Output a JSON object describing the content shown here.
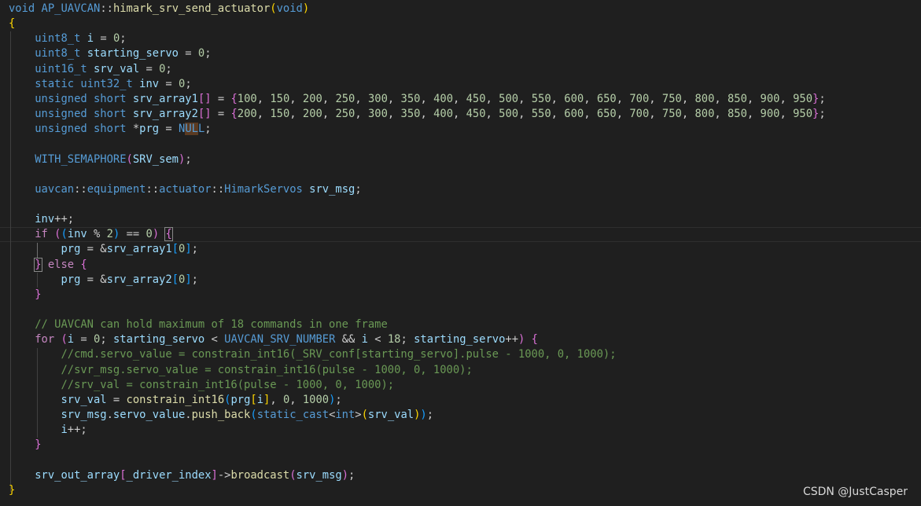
{
  "colors": {
    "background": "#1f1f1f",
    "keyword": "#569cd6",
    "control": "#c586c0",
    "function": "#dcdcaa",
    "variable": "#9cdcfe",
    "number": "#b5cea8",
    "comment": "#6a9955",
    "punctuation": "#cccccc",
    "brace1": "#ffd700",
    "brace2": "#da70d6",
    "brace3": "#179fff",
    "constant": "#4fc1ff"
  },
  "watermark": "CSDN @JustCasper",
  "code": {
    "lines": [
      [
        [
          "void",
          "keyword"
        ],
        [
          " ",
          "punctuation"
        ],
        [
          "AP_UAVCAN",
          "type"
        ],
        [
          "::",
          "punctuation"
        ],
        [
          "himark_srv_send_actuator",
          "function"
        ],
        [
          "(",
          "brace1"
        ],
        [
          "void",
          "keyword"
        ],
        [
          ")",
          "brace1"
        ]
      ],
      [
        [
          "{",
          "brace1"
        ]
      ],
      [
        [
          "    ",
          "punctuation"
        ],
        [
          "uint8_t",
          "keyword"
        ],
        [
          " ",
          "punctuation"
        ],
        [
          "i",
          "variable"
        ],
        [
          " = ",
          "punctuation"
        ],
        [
          "0",
          "number"
        ],
        [
          ";",
          "punctuation"
        ]
      ],
      [
        [
          "    ",
          "punctuation"
        ],
        [
          "uint8_t",
          "keyword"
        ],
        [
          " ",
          "punctuation"
        ],
        [
          "starting_servo",
          "variable"
        ],
        [
          " = ",
          "punctuation"
        ],
        [
          "0",
          "number"
        ],
        [
          ";",
          "punctuation"
        ]
      ],
      [
        [
          "    ",
          "punctuation"
        ],
        [
          "uint16_t",
          "keyword"
        ],
        [
          " ",
          "punctuation"
        ],
        [
          "srv_val",
          "variable"
        ],
        [
          " = ",
          "punctuation"
        ],
        [
          "0",
          "number"
        ],
        [
          ";",
          "punctuation"
        ]
      ],
      [
        [
          "    ",
          "punctuation"
        ],
        [
          "static",
          "keyword"
        ],
        [
          " ",
          "punctuation"
        ],
        [
          "uint32_t",
          "keyword"
        ],
        [
          " ",
          "punctuation"
        ],
        [
          "inv",
          "variable"
        ],
        [
          " = ",
          "punctuation"
        ],
        [
          "0",
          "number"
        ],
        [
          ";",
          "punctuation"
        ]
      ],
      [
        [
          "    ",
          "punctuation"
        ],
        [
          "unsigned",
          "keyword"
        ],
        [
          " ",
          "punctuation"
        ],
        [
          "short",
          "keyword"
        ],
        [
          " ",
          "punctuation"
        ],
        [
          "srv_array1",
          "variable"
        ],
        [
          "[]",
          "brace2"
        ],
        [
          " = ",
          "punctuation"
        ],
        [
          "{",
          "brace2"
        ],
        [
          "100",
          "number"
        ],
        [
          ", ",
          "punctuation"
        ],
        [
          "150",
          "number"
        ],
        [
          ", ",
          "punctuation"
        ],
        [
          "200",
          "number"
        ],
        [
          ", ",
          "punctuation"
        ],
        [
          "250",
          "number"
        ],
        [
          ", ",
          "punctuation"
        ],
        [
          "300",
          "number"
        ],
        [
          ", ",
          "punctuation"
        ],
        [
          "350",
          "number"
        ],
        [
          ", ",
          "punctuation"
        ],
        [
          "400",
          "number"
        ],
        [
          ", ",
          "punctuation"
        ],
        [
          "450",
          "number"
        ],
        [
          ", ",
          "punctuation"
        ],
        [
          "500",
          "number"
        ],
        [
          ", ",
          "punctuation"
        ],
        [
          "550",
          "number"
        ],
        [
          ", ",
          "punctuation"
        ],
        [
          "600",
          "number"
        ],
        [
          ", ",
          "punctuation"
        ],
        [
          "650",
          "number"
        ],
        [
          ", ",
          "punctuation"
        ],
        [
          "700",
          "number"
        ],
        [
          ", ",
          "punctuation"
        ],
        [
          "750",
          "number"
        ],
        [
          ", ",
          "punctuation"
        ],
        [
          "800",
          "number"
        ],
        [
          ", ",
          "punctuation"
        ],
        [
          "850",
          "number"
        ],
        [
          ", ",
          "punctuation"
        ],
        [
          "900",
          "number"
        ],
        [
          ", ",
          "punctuation"
        ],
        [
          "950",
          "number"
        ],
        [
          "}",
          "brace2"
        ],
        [
          ";",
          "punctuation"
        ]
      ],
      [
        [
          "    ",
          "punctuation"
        ],
        [
          "unsigned",
          "keyword"
        ],
        [
          " ",
          "punctuation"
        ],
        [
          "short",
          "keyword"
        ],
        [
          " ",
          "punctuation"
        ],
        [
          "srv_array2",
          "variable"
        ],
        [
          "[]",
          "brace2"
        ],
        [
          " = ",
          "punctuation"
        ],
        [
          "{",
          "brace2"
        ],
        [
          "200",
          "number"
        ],
        [
          ", ",
          "punctuation"
        ],
        [
          "150",
          "number"
        ],
        [
          ", ",
          "punctuation"
        ],
        [
          "200",
          "number"
        ],
        [
          ", ",
          "punctuation"
        ],
        [
          "250",
          "number"
        ],
        [
          ", ",
          "punctuation"
        ],
        [
          "300",
          "number"
        ],
        [
          ", ",
          "punctuation"
        ],
        [
          "350",
          "number"
        ],
        [
          ", ",
          "punctuation"
        ],
        [
          "400",
          "number"
        ],
        [
          ", ",
          "punctuation"
        ],
        [
          "450",
          "number"
        ],
        [
          ", ",
          "punctuation"
        ],
        [
          "500",
          "number"
        ],
        [
          ", ",
          "punctuation"
        ],
        [
          "550",
          "number"
        ],
        [
          ", ",
          "punctuation"
        ],
        [
          "600",
          "number"
        ],
        [
          ", ",
          "punctuation"
        ],
        [
          "650",
          "number"
        ],
        [
          ", ",
          "punctuation"
        ],
        [
          "700",
          "number"
        ],
        [
          ", ",
          "punctuation"
        ],
        [
          "750",
          "number"
        ],
        [
          ", ",
          "punctuation"
        ],
        [
          "800",
          "number"
        ],
        [
          ", ",
          "punctuation"
        ],
        [
          "850",
          "number"
        ],
        [
          ", ",
          "punctuation"
        ],
        [
          "900",
          "number"
        ],
        [
          ", ",
          "punctuation"
        ],
        [
          "950",
          "number"
        ],
        [
          "}",
          "brace2"
        ],
        [
          ";",
          "punctuation"
        ]
      ],
      [
        [
          "    ",
          "punctuation"
        ],
        [
          "unsigned",
          "keyword"
        ],
        [
          " ",
          "punctuation"
        ],
        [
          "short",
          "keyword"
        ],
        [
          " *",
          "punctuation"
        ],
        [
          "prg",
          "variable"
        ],
        [
          " = ",
          "punctuation"
        ],
        [
          "N",
          "keyword"
        ],
        [
          "UL",
          "keyword-hl"
        ],
        [
          "L",
          "keyword"
        ],
        [
          ";",
          "punctuation"
        ]
      ],
      [],
      [
        [
          "    ",
          "punctuation"
        ],
        [
          "WITH_SEMAPHORE",
          "keyword"
        ],
        [
          "(",
          "brace2"
        ],
        [
          "SRV_sem",
          "variable"
        ],
        [
          ")",
          "brace2"
        ],
        [
          ";",
          "punctuation"
        ]
      ],
      [],
      [
        [
          "    ",
          "punctuation"
        ],
        [
          "uavcan",
          "type"
        ],
        [
          "::",
          "punctuation"
        ],
        [
          "equipment",
          "type"
        ],
        [
          "::",
          "punctuation"
        ],
        [
          "actuator",
          "type"
        ],
        [
          "::",
          "punctuation"
        ],
        [
          "HimarkServos",
          "type"
        ],
        [
          " ",
          "punctuation"
        ],
        [
          "srv_msg",
          "variable"
        ],
        [
          ";",
          "punctuation"
        ]
      ],
      [],
      [
        [
          "    ",
          "punctuation"
        ],
        [
          "inv",
          "variable"
        ],
        [
          "++;",
          "punctuation"
        ]
      ],
      [
        [
          "    ",
          "punctuation"
        ],
        [
          "if",
          "control"
        ],
        [
          " ",
          "punctuation"
        ],
        [
          "(",
          "brace2"
        ],
        [
          "(",
          "brace3"
        ],
        [
          "inv",
          "variable"
        ],
        [
          " % ",
          "punctuation"
        ],
        [
          "2",
          "number"
        ],
        [
          ")",
          "brace3"
        ],
        [
          " == ",
          "punctuation"
        ],
        [
          "0",
          "number"
        ],
        [
          ")",
          "brace2"
        ],
        [
          " ",
          "punctuation"
        ],
        [
          "{",
          "brace2-box"
        ]
      ],
      [
        [
          "        ",
          "punctuation"
        ],
        [
          "prg",
          "variable"
        ],
        [
          " = &",
          "punctuation"
        ],
        [
          "srv_array1",
          "variable"
        ],
        [
          "[",
          "brace3"
        ],
        [
          "0",
          "number"
        ],
        [
          "]",
          "brace3"
        ],
        [
          ";",
          "punctuation"
        ]
      ],
      [
        [
          "    ",
          "punctuation"
        ],
        [
          "}",
          "brace2-box"
        ],
        [
          " ",
          "punctuation"
        ],
        [
          "else",
          "control"
        ],
        [
          " ",
          "punctuation"
        ],
        [
          "{",
          "brace2"
        ]
      ],
      [
        [
          "        ",
          "punctuation"
        ],
        [
          "prg",
          "variable"
        ],
        [
          " = &",
          "punctuation"
        ],
        [
          "srv_array2",
          "variable"
        ],
        [
          "[",
          "brace3"
        ],
        [
          "0",
          "number"
        ],
        [
          "]",
          "brace3"
        ],
        [
          ";",
          "punctuation"
        ]
      ],
      [
        [
          "    ",
          "punctuation"
        ],
        [
          "}",
          "brace2"
        ]
      ],
      [],
      [
        [
          "    ",
          "punctuation"
        ],
        [
          "// UAVCAN can hold maximum of 18 commands in one frame",
          "comment"
        ]
      ],
      [
        [
          "    ",
          "punctuation"
        ],
        [
          "for",
          "control"
        ],
        [
          " ",
          "punctuation"
        ],
        [
          "(",
          "brace2"
        ],
        [
          "i",
          "variable"
        ],
        [
          " = ",
          "punctuation"
        ],
        [
          "0",
          "number"
        ],
        [
          "; ",
          "punctuation"
        ],
        [
          "starting_servo",
          "variable"
        ],
        [
          " < ",
          "punctuation"
        ],
        [
          "UAVCAN_SRV_NUMBER",
          "keyword"
        ],
        [
          " && ",
          "punctuation"
        ],
        [
          "i",
          "variable"
        ],
        [
          " < ",
          "punctuation"
        ],
        [
          "18",
          "number"
        ],
        [
          "; ",
          "punctuation"
        ],
        [
          "starting_servo",
          "variable"
        ],
        [
          "++",
          "punctuation"
        ],
        [
          ")",
          "brace2"
        ],
        [
          " ",
          "punctuation"
        ],
        [
          "{",
          "brace2"
        ]
      ],
      [
        [
          "        ",
          "punctuation"
        ],
        [
          "//cmd.servo_value = constrain_int16(_SRV_conf[starting_servo].pulse - 1000, 0, 1000);",
          "comment"
        ]
      ],
      [
        [
          "        ",
          "punctuation"
        ],
        [
          "//svr_msg.servo_value = constrain_int16(pulse - 1000, 0, 1000);",
          "comment"
        ]
      ],
      [
        [
          "        ",
          "punctuation"
        ],
        [
          "//srv_val = constrain_int16(pulse - 1000, 0, 1000);",
          "comment"
        ]
      ],
      [
        [
          "        ",
          "punctuation"
        ],
        [
          "srv_val",
          "variable"
        ],
        [
          " = ",
          "punctuation"
        ],
        [
          "constrain_int16",
          "function"
        ],
        [
          "(",
          "brace3"
        ],
        [
          "prg",
          "variable"
        ],
        [
          "[",
          "brace1"
        ],
        [
          "i",
          "variable"
        ],
        [
          "]",
          "brace1"
        ],
        [
          ", ",
          "punctuation"
        ],
        [
          "0",
          "number"
        ],
        [
          ", ",
          "punctuation"
        ],
        [
          "1000",
          "number"
        ],
        [
          ")",
          "brace3"
        ],
        [
          ";",
          "punctuation"
        ]
      ],
      [
        [
          "        ",
          "punctuation"
        ],
        [
          "srv_msg",
          "variable"
        ],
        [
          ".",
          "punctuation"
        ],
        [
          "servo_value",
          "variable"
        ],
        [
          ".",
          "punctuation"
        ],
        [
          "push_back",
          "function"
        ],
        [
          "(",
          "brace3"
        ],
        [
          "static_cast",
          "keyword"
        ],
        [
          "<",
          "punctuation"
        ],
        [
          "int",
          "keyword"
        ],
        [
          ">",
          "punctuation"
        ],
        [
          "(",
          "brace1"
        ],
        [
          "srv_val",
          "variable"
        ],
        [
          ")",
          "brace1"
        ],
        [
          ")",
          "brace3"
        ],
        [
          ";",
          "punctuation"
        ]
      ],
      [
        [
          "        ",
          "punctuation"
        ],
        [
          "i",
          "variable"
        ],
        [
          "++;",
          "punctuation"
        ]
      ],
      [
        [
          "    ",
          "punctuation"
        ],
        [
          "}",
          "brace2"
        ]
      ],
      [],
      [
        [
          "    ",
          "punctuation"
        ],
        [
          "srv_out_array",
          "variable"
        ],
        [
          "[",
          "brace2"
        ],
        [
          "_driver_index",
          "variable"
        ],
        [
          "]",
          "brace2"
        ],
        [
          "->",
          "punctuation"
        ],
        [
          "broadcast",
          "function"
        ],
        [
          "(",
          "brace2"
        ],
        [
          "srv_msg",
          "variable"
        ],
        [
          ")",
          "brace2"
        ],
        [
          ";",
          "punctuation"
        ]
      ],
      [
        [
          "}",
          "brace1"
        ]
      ]
    ]
  }
}
